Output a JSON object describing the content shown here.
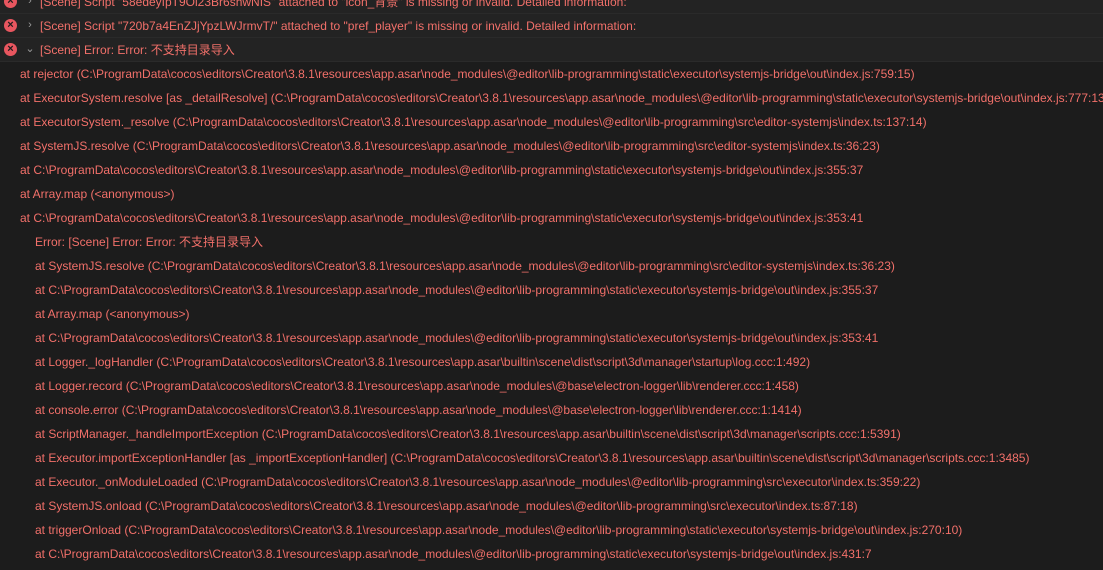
{
  "log": {
    "entries": [
      {
        "icon": "error-icon",
        "expanded": false,
        "text": "[Scene] Script \"58edeyIpT9Oi23Br6shwNIS\" attached to \"icon_背景\" is missing or invalid. Detailed information:"
      },
      {
        "icon": "error-icon",
        "expanded": false,
        "text": "[Scene] Script \"720b7a4EnZJjYpzLWJrmvT/\" attached to \"pref_player\" is missing or invalid. Detailed information:"
      },
      {
        "icon": "error-icon",
        "expanded": true,
        "text": "[Scene] Error: Error: 不支持目录导入"
      }
    ],
    "stack": [
      "at rejector (C:\\ProgramData\\cocos\\editors\\Creator\\3.8.1\\resources\\app.asar\\node_modules\\@editor\\lib-programming\\static\\executor\\systemjs-bridge\\out\\index.js:759:15)",
      "at ExecutorSystem.resolve [as _detailResolve] (C:\\ProgramData\\cocos\\editors\\Creator\\3.8.1\\resources\\app.asar\\node_modules\\@editor\\lib-programming\\static\\executor\\systemjs-bridge\\out\\index.js:777:13",
      "at ExecutorSystem._resolve (C:\\ProgramData\\cocos\\editors\\Creator\\3.8.1\\resources\\app.asar\\node_modules\\@editor\\lib-programming\\src\\editor-systemjs\\index.ts:137:14)",
      "at SystemJS.resolve (C:\\ProgramData\\cocos\\editors\\Creator\\3.8.1\\resources\\app.asar\\node_modules\\@editor\\lib-programming\\src\\editor-systemjs\\index.ts:36:23)",
      "at C:\\ProgramData\\cocos\\editors\\Creator\\3.8.1\\resources\\app.asar\\node_modules\\@editor\\lib-programming\\static\\executor\\systemjs-bridge\\out\\index.js:355:37",
      "at Array.map (<anonymous>)",
      "at C:\\ProgramData\\cocos\\editors\\Creator\\3.8.1\\resources\\app.asar\\node_modules\\@editor\\lib-programming\\static\\executor\\systemjs-bridge\\out\\index.js:353:41"
    ],
    "nested_stack": [
      "Error: [Scene] Error: Error: 不支持目录导入",
      "at SystemJS.resolve (C:\\ProgramData\\cocos\\editors\\Creator\\3.8.1\\resources\\app.asar\\node_modules\\@editor\\lib-programming\\src\\editor-systemjs\\index.ts:36:23)",
      "at C:\\ProgramData\\cocos\\editors\\Creator\\3.8.1\\resources\\app.asar\\node_modules\\@editor\\lib-programming\\static\\executor\\systemjs-bridge\\out\\index.js:355:37",
      "at Array.map (<anonymous>)",
      "at C:\\ProgramData\\cocos\\editors\\Creator\\3.8.1\\resources\\app.asar\\node_modules\\@editor\\lib-programming\\static\\executor\\systemjs-bridge\\out\\index.js:353:41",
      "at Logger._logHandler (C:\\ProgramData\\cocos\\editors\\Creator\\3.8.1\\resources\\app.asar\\builtin\\scene\\dist\\script\\3d\\manager\\startup\\log.ccc:1:492)",
      "at Logger.record (C:\\ProgramData\\cocos\\editors\\Creator\\3.8.1\\resources\\app.asar\\node_modules\\@base\\electron-logger\\lib\\renderer.ccc:1:458)",
      "at console.error (C:\\ProgramData\\cocos\\editors\\Creator\\3.8.1\\resources\\app.asar\\node_modules\\@base\\electron-logger\\lib\\renderer.ccc:1:1414)",
      "at ScriptManager._handleImportException (C:\\ProgramData\\cocos\\editors\\Creator\\3.8.1\\resources\\app.asar\\builtin\\scene\\dist\\script\\3d\\manager\\scripts.ccc:1:5391)",
      "at Executor.importExceptionHandler [as _importExceptionHandler] (C:\\ProgramData\\cocos\\editors\\Creator\\3.8.1\\resources\\app.asar\\builtin\\scene\\dist\\script\\3d\\manager\\scripts.ccc:1:3485)",
      "at Executor._onModuleLoaded (C:\\ProgramData\\cocos\\editors\\Creator\\3.8.1\\resources\\app.asar\\node_modules\\@editor\\lib-programming\\src\\executor\\index.ts:359:22)",
      "at SystemJS.onload (C:\\ProgramData\\cocos\\editors\\Creator\\3.8.1\\resources\\app.asar\\node_modules\\@editor\\lib-programming\\src\\executor\\index.ts:87:18)",
      "at triggerOnload (C:\\ProgramData\\cocos\\editors\\Creator\\3.8.1\\resources\\app.asar\\node_modules\\@editor\\lib-programming\\static\\executor\\systemjs-bridge\\out\\index.js:270:10)",
      "at C:\\ProgramData\\cocos\\editors\\Creator\\3.8.1\\resources\\app.asar\\node_modules\\@editor\\lib-programming\\static\\executor\\systemjs-bridge\\out\\index.js:431:7"
    ]
  },
  "colors": {
    "background": "#1c1c1c",
    "header_background": "#232323",
    "error_text": "#f2706a",
    "error_icon": "#e8565f",
    "chevron": "#9a9a9a"
  }
}
